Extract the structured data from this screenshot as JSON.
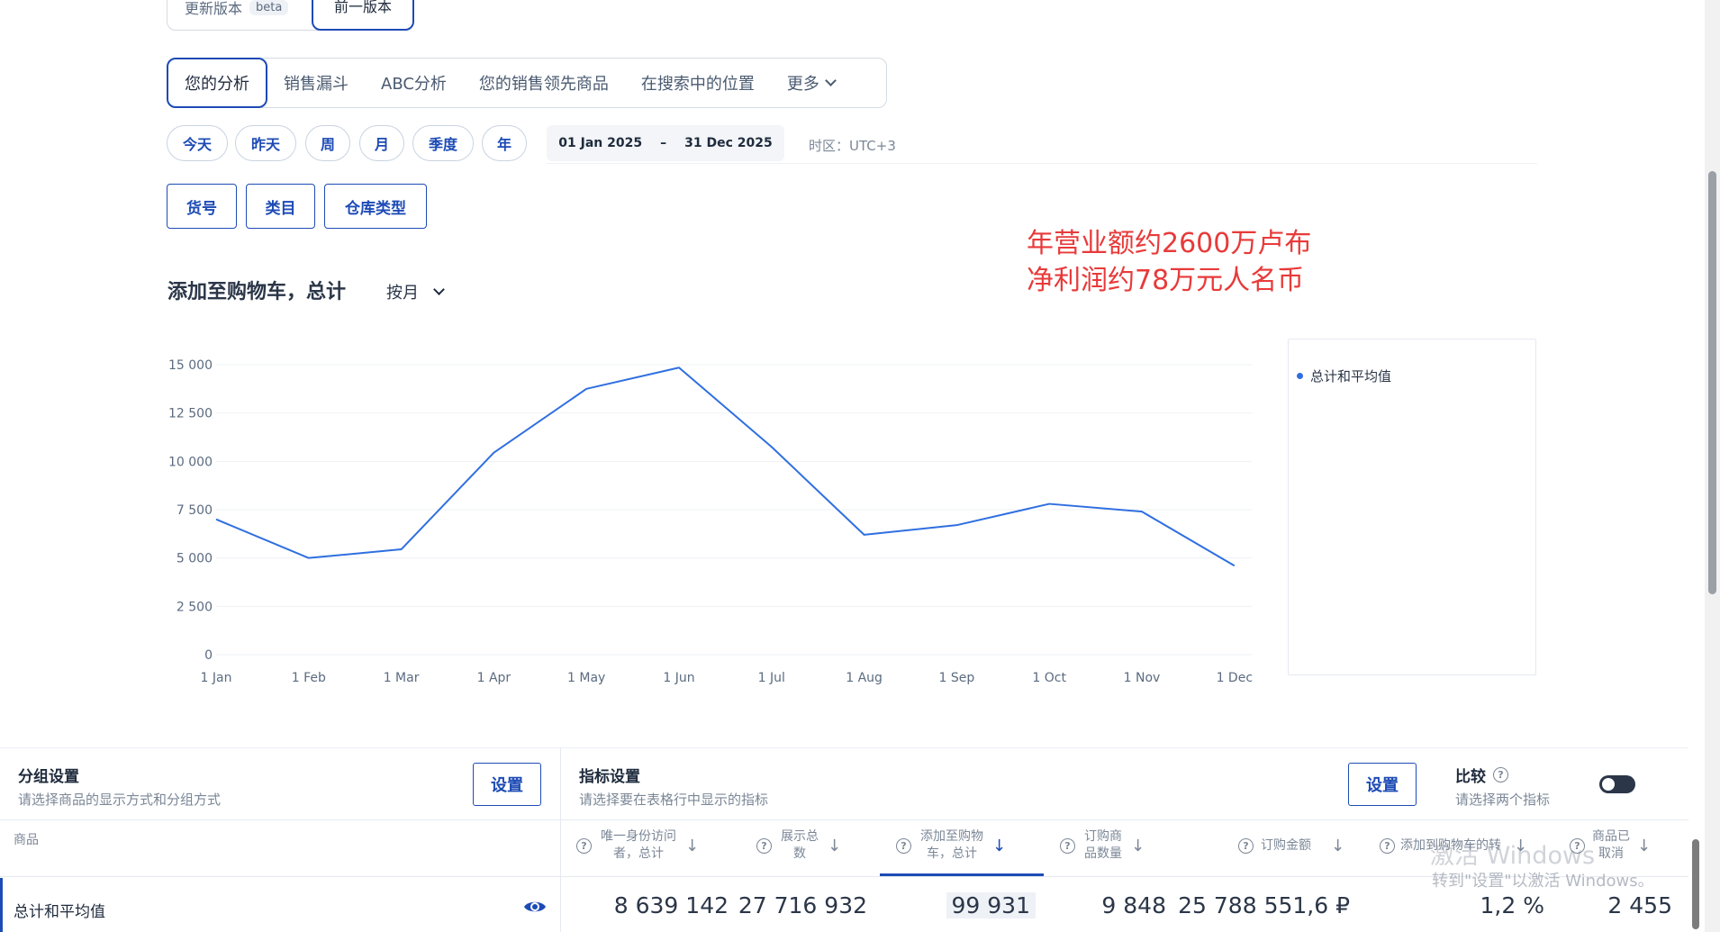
{
  "version": {
    "new_label": "更新版本",
    "beta": "beta",
    "prev_label": "前一版本"
  },
  "tabs": [
    {
      "label": "您的分析",
      "active": true
    },
    {
      "label": "销售漏斗"
    },
    {
      "label": "ABC分析"
    },
    {
      "label": "您的销售领先商品"
    },
    {
      "label": "在搜索中的位置"
    },
    {
      "label": "更多"
    }
  ],
  "periods": [
    "今天",
    "昨天",
    "周",
    "月",
    "季度",
    "年"
  ],
  "date_range": {
    "start": "01 Jan 2025",
    "sep": "–",
    "end": "31 Dec 2025"
  },
  "timezone": {
    "label": "时区：",
    "value": "UTC+3"
  },
  "filters": [
    "货号",
    "类目",
    "仓库类型"
  ],
  "annotation": {
    "line1": "年营业额约2600万卢布",
    "line2": "净利润约78万元人名币"
  },
  "chart_section": {
    "title": "添加至购物车，总计",
    "granularity": "按月"
  },
  "chart_data": {
    "type": "line",
    "categories": [
      "1 Jan",
      "1 Feb",
      "1 Mar",
      "1 Apr",
      "1 May",
      "1 Jun",
      "1 Jul",
      "1 Aug",
      "1 Sep",
      "1 Oct",
      "1 Nov",
      "1 Dec"
    ],
    "series": [
      {
        "name": "总计和平均值",
        "values": [
          7000,
          5000,
          5450,
          10450,
          13750,
          14850,
          10750,
          6200,
          6700,
          7800,
          7400,
          4600
        ],
        "color": "#2f6fe0"
      }
    ],
    "yticks": [
      0,
      2500,
      5000,
      7500,
      10000,
      12500,
      15000
    ],
    "ytick_labels": [
      "0",
      "2 500",
      "5 000",
      "7 500",
      "10 000",
      "12 500",
      "15 000"
    ],
    "ylim": [
      0,
      15000
    ],
    "grid": true,
    "legend_position": "right"
  },
  "grouping": {
    "title": "分组设置",
    "subtitle": "请选择商品的显示方式和分组方式",
    "button": "设置"
  },
  "metrics": {
    "title": "指标设置",
    "subtitle": "请选择要在表格行中显示的指标",
    "button": "设置"
  },
  "compare": {
    "title": "比较",
    "subtitle": "请选择两个指标",
    "enabled": false
  },
  "table": {
    "product_header": "商品",
    "columns": [
      {
        "l1": "唯一身份访问",
        "l2": "者，总计"
      },
      {
        "l1": "展示总",
        "l2": "数"
      },
      {
        "l1": "添加至购物",
        "l2": "车，总计"
      },
      {
        "l1": "订购商",
        "l2": "品数量"
      },
      {
        "l1": "订购金额",
        "l2": ""
      },
      {
        "l1": "添加到购物车的转",
        "l2": ""
      },
      {
        "l1": "商品已",
        "l2": "取消"
      }
    ],
    "row": {
      "label": "总计和平均值",
      "values": [
        "8 639 142",
        "27 716 932",
        "99 931",
        "9 848",
        "25 788 551,6 ₽",
        "1,2 %",
        "2 455"
      ]
    }
  },
  "watermark": {
    "line1": "激活 Windows",
    "line2": "转到\"设置\"以激活 Windows。"
  },
  "question_mark": "?"
}
